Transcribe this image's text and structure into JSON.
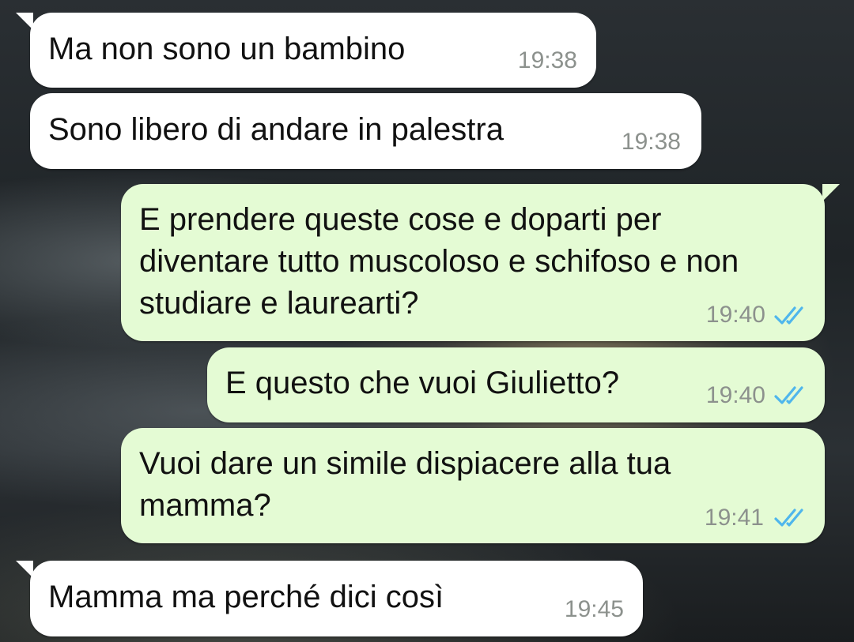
{
  "messages": [
    {
      "direction": "incoming",
      "text": "Ma non sono un bambino",
      "time": "19:38"
    },
    {
      "direction": "incoming",
      "text": "Sono libero di andare in palestra",
      "time": "19:38"
    },
    {
      "direction": "outgoing",
      "text": "E prendere queste cose e doparti per\ndiventare tutto muscoloso e schifoso e non\nstudiare e laurearti?",
      "time": "19:40",
      "status": "read"
    },
    {
      "direction": "outgoing",
      "text": "E questo che vuoi Giulietto?",
      "time": "19:40",
      "status": "read"
    },
    {
      "direction": "outgoing",
      "text": "Vuoi dare un simile dispiacere alla tua\nmamma?",
      "time": "19:41",
      "status": "read"
    },
    {
      "direction": "incoming",
      "text": "Mamma ma perché dici così",
      "time": "19:45"
    }
  ],
  "colors": {
    "incoming_bubble": "#ffffff",
    "outgoing_bubble": "#e4fbd4",
    "read_ticks": "#4fb6ec",
    "timestamp": "#8c918d"
  },
  "icons": {
    "read_status": "double-check-icon"
  }
}
